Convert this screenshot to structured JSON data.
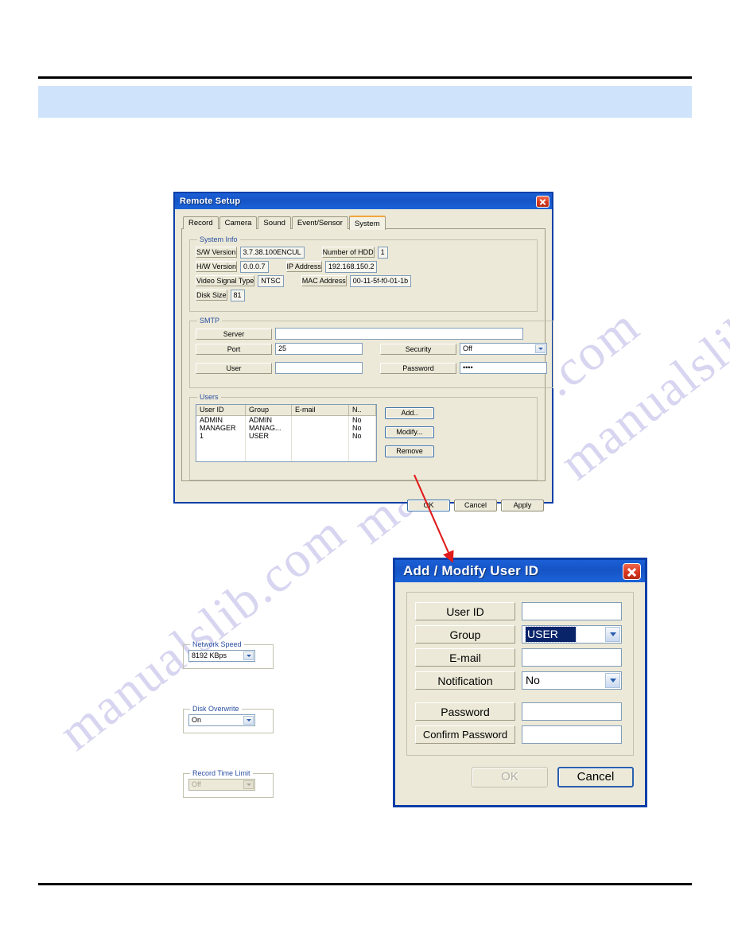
{
  "page": {
    "header_band_color": "#cfe4fa",
    "rule_color": "#000000",
    "watermark_lines": [
      "manualslib.com",
      "manualslib.com",
      "manualslib.com"
    ]
  },
  "remote_setup": {
    "title": "Remote Setup",
    "close_icon": "close-icon",
    "tabs": [
      {
        "label": "Record",
        "active": false
      },
      {
        "label": "Camera",
        "active": false
      },
      {
        "label": "Sound",
        "active": false
      },
      {
        "label": "Event/Sensor",
        "active": false
      },
      {
        "label": "System",
        "active": true
      }
    ],
    "system_info": {
      "legend": "System Info",
      "left_rows": [
        {
          "label": "S/W Version",
          "value": "3.7.38.100ENCUL"
        },
        {
          "label": "H/W Version",
          "value": "0.0.0.7"
        },
        {
          "label": "Video Signal Type",
          "value": "NTSC"
        },
        {
          "label": "Disk Size",
          "value": "81"
        }
      ],
      "right_rows": [
        {
          "label": "Number of HDD",
          "value": "1"
        },
        {
          "label": "IP Address",
          "value": "192.168.150.2"
        },
        {
          "label": "MAC Address",
          "value": "00-11-5f-f0-01-1b"
        }
      ]
    },
    "smtp": {
      "legend": "SMTP",
      "server_label": "Server",
      "server_value": "",
      "port_label": "Port",
      "port_value": "25",
      "security_label": "Security",
      "security_value": "Off",
      "user_label": "User",
      "user_value": "",
      "password_label": "Password",
      "password_value": "••••"
    },
    "users": {
      "legend": "Users",
      "columns": [
        "User ID",
        "Group",
        "E-mail",
        "N.."
      ],
      "rows": [
        [
          "ADMIN",
          "ADMIN",
          "",
          "No"
        ],
        [
          "MANAGER",
          "MANAG...",
          "",
          "No"
        ],
        [
          "1",
          "USER",
          "",
          "No"
        ],
        [
          "",
          "",
          "",
          ""
        ],
        [
          "",
          "",
          "",
          ""
        ],
        [
          "",
          "",
          "",
          ""
        ]
      ],
      "add_label": "Add..",
      "modify_label": "Modify...",
      "remove_label": "Remove"
    },
    "network_speed": {
      "legend": "Network Speed",
      "value": "8192 KBps"
    },
    "disk_overwrite": {
      "legend": "Disk Overwrite",
      "value": "On"
    },
    "record_time_limit": {
      "legend": "Record Time Limit",
      "value": "Off",
      "disabled": true
    },
    "footer": {
      "ok_label": "OK",
      "cancel_label": "Cancel",
      "apply_label": "Apply"
    }
  },
  "add_modify_user": {
    "title": "Add / Modify User ID",
    "close_icon": "close-icon",
    "fields": [
      {
        "label": "User ID",
        "value": "",
        "kind": "text"
      },
      {
        "label": "Group",
        "value": "USER",
        "kind": "combo"
      },
      {
        "label": "E-mail",
        "value": "",
        "kind": "text"
      },
      {
        "label": "Notification",
        "value": "No",
        "kind": "combo"
      },
      {
        "label": "Password",
        "value": "",
        "kind": "text"
      },
      {
        "label": "Confirm Password",
        "value": "",
        "kind": "text"
      }
    ],
    "ok_label": "OK",
    "cancel_label": "Cancel"
  },
  "annotation": {
    "arrow_color": "#e01b1b",
    "arrow_name": "red-pointer-arrow"
  }
}
